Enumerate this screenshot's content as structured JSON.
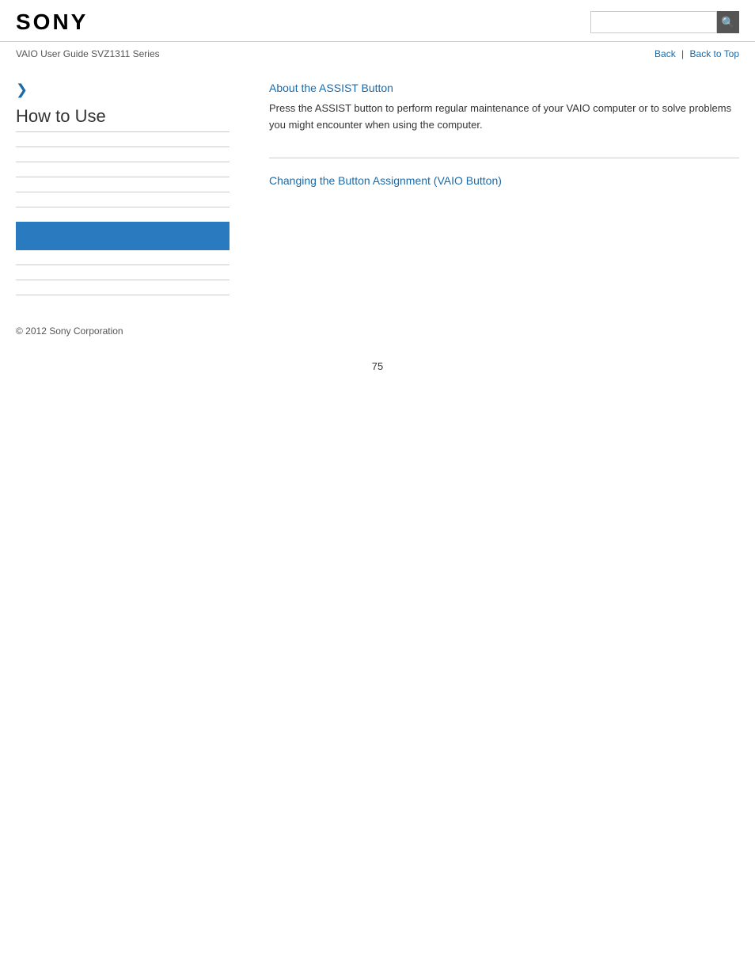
{
  "header": {
    "logo": "SONY",
    "search_placeholder": "",
    "search_icon": "🔍"
  },
  "sub_header": {
    "guide_title": "VAIO User Guide SVZ1311 Series",
    "nav": {
      "back_label": "Back",
      "separator": "|",
      "back_top_label": "Back to Top"
    }
  },
  "sidebar": {
    "chevron": "❯",
    "title": "How to Use",
    "divider_count": 8
  },
  "content": {
    "section1": {
      "link": "About the ASSIST Button",
      "description": "Press the ASSIST button to perform regular maintenance of your VAIO computer or to solve problems you might encounter when using the computer."
    },
    "section2": {
      "link": "Changing the Button Assignment (VAIO Button)"
    }
  },
  "footer": {
    "copyright": "© 2012 Sony Corporation"
  },
  "page_number": "75",
  "colors": {
    "link": "#1a6aaa",
    "highlight_bar": "#2a7abf",
    "divider": "#ccc"
  }
}
